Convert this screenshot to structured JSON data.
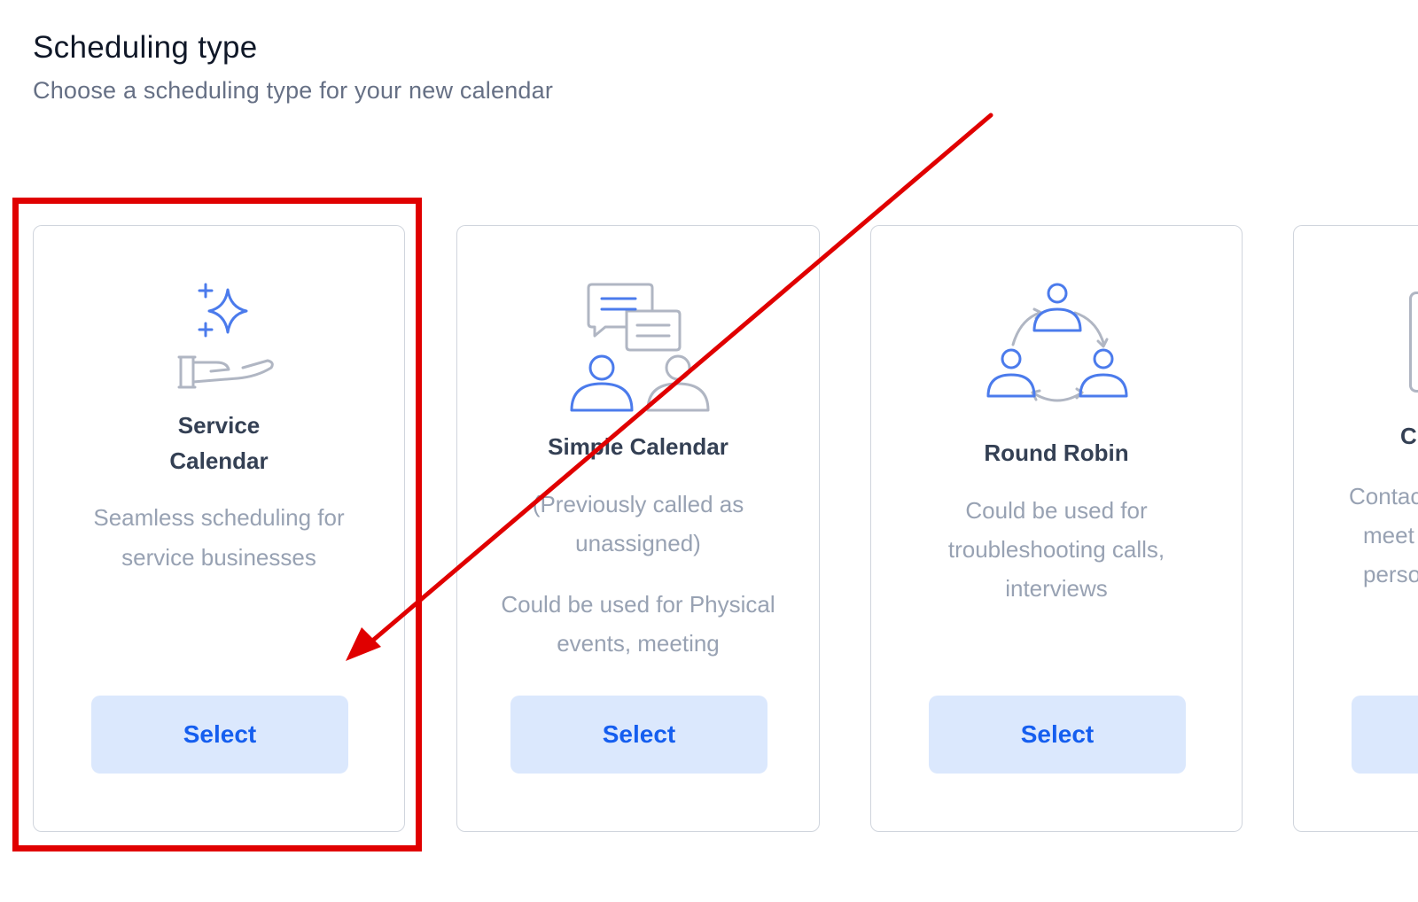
{
  "header": {
    "title": "Scheduling type",
    "subtitle": "Choose a scheduling type for your new calendar"
  },
  "cards": [
    {
      "title_line1": "Service",
      "title_line2": "Calendar",
      "desc_line1": "Seamless scheduling for",
      "desc_line2": "service businesses",
      "button": "Select",
      "icon": "sparkle-hand-icon"
    },
    {
      "title": "Simple Calendar",
      "desc_line1": "(Previously called as",
      "desc_line2": "unassigned)",
      "desc_line3": "Could be used for Physical",
      "desc_line4": "events, meeting",
      "button": "Select",
      "icon": "chat-people-icon"
    },
    {
      "title": "Round Robin",
      "desc_line1": "Could be used for",
      "desc_line2": "troubleshooting calls,",
      "desc_line3": "interviews",
      "button": "Select",
      "icon": "round-robin-people-icon"
    },
    {
      "title_partial": "C",
      "desc_line1": "Contac",
      "desc_line2": "meet",
      "desc_line3": "perso",
      "icon": "partial-icon"
    }
  ],
  "colors": {
    "accent_blue": "#155eef",
    "button_bg": "#dbe8fd",
    "icon_blue": "#4b7bec",
    "icon_gray": "#b0b6c3",
    "annotation_red": "#e00000"
  }
}
